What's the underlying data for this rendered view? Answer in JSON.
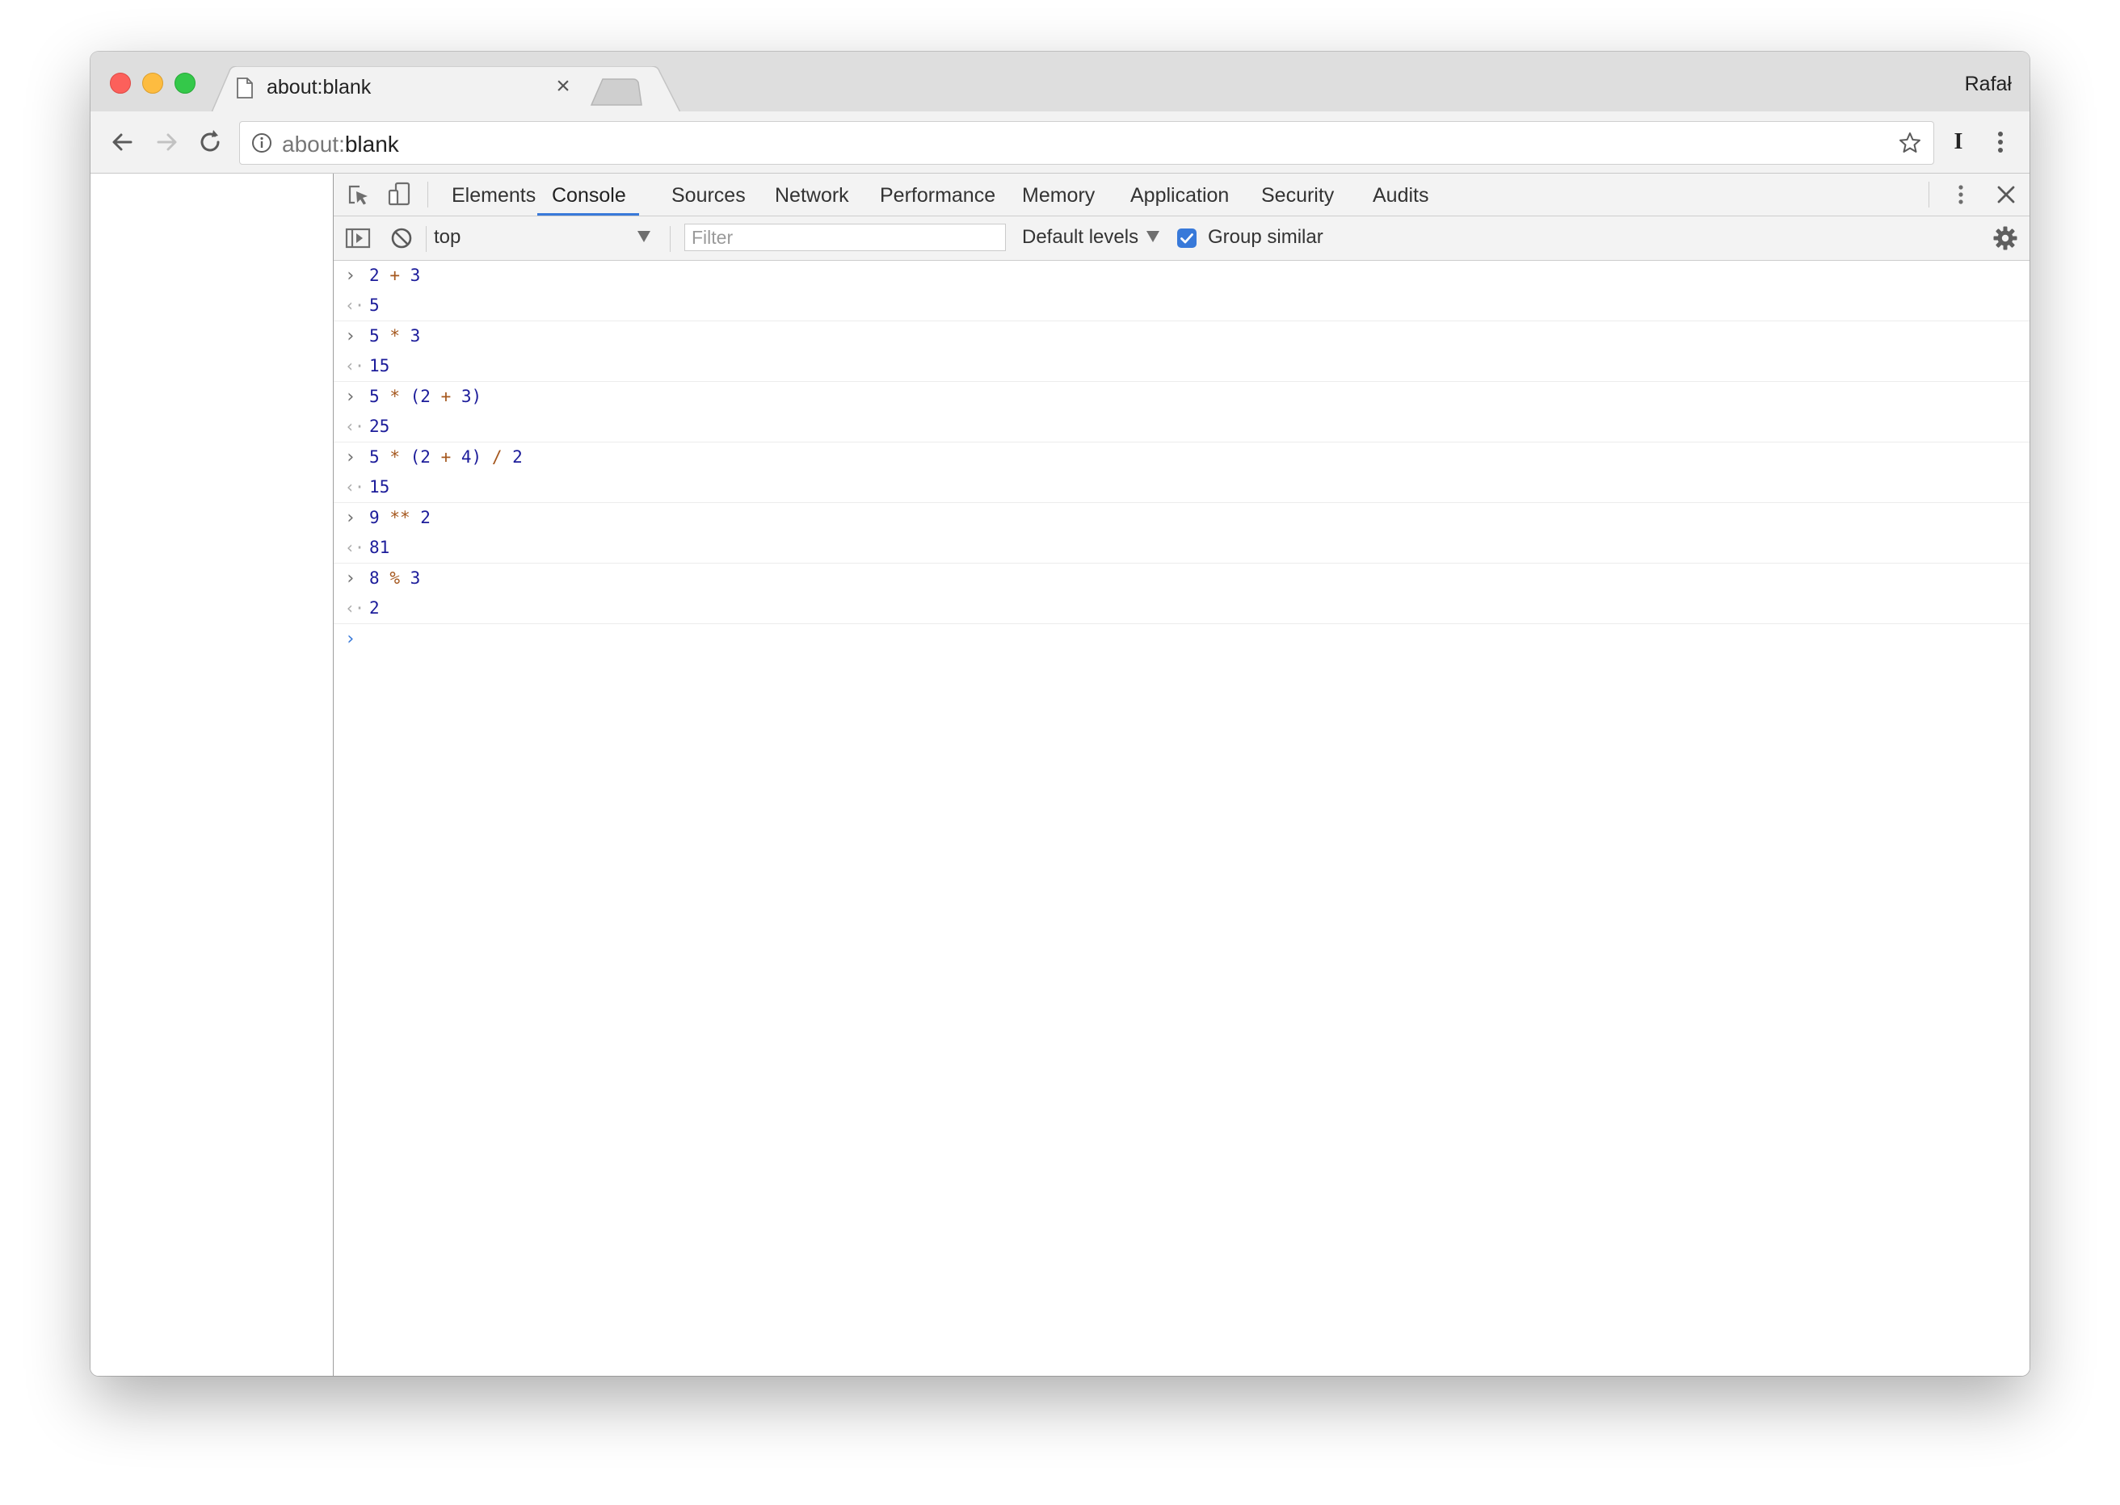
{
  "tab": {
    "title": "about:blank",
    "close_glyph": "×"
  },
  "profile": {
    "name": "Rafał"
  },
  "address_bar": {
    "scheme": "about:",
    "path": "blank"
  },
  "toolbar": {
    "extension_glyph": "I"
  },
  "devtools": {
    "tabs": [
      "Elements",
      "Console",
      "Sources",
      "Network",
      "Performance",
      "Memory",
      "Application",
      "Security",
      "Audits"
    ],
    "active_tab": "Console",
    "accent_color": "#3879d9"
  },
  "console_toolbar": {
    "context": "top",
    "filter_placeholder": "Filter",
    "levels_label": "Default levels",
    "group_similar_label": "Group similar",
    "group_similar_checked": true
  },
  "console": {
    "entries": [
      {
        "input": [
          "2",
          "+",
          "3"
        ],
        "result": "5"
      },
      {
        "input": [
          "5",
          "*",
          "3"
        ],
        "result": "15"
      },
      {
        "input": [
          "5",
          "*",
          "(2",
          "+",
          "3)"
        ],
        "result": "25"
      },
      {
        "input": [
          "5",
          "*",
          "(2",
          "+",
          "4)",
          "/",
          "2"
        ],
        "result": "15"
      },
      {
        "input": [
          "9",
          "**",
          "2"
        ],
        "result": "81"
      },
      {
        "input": [
          "8",
          "%",
          "3"
        ],
        "result": "2"
      }
    ]
  }
}
